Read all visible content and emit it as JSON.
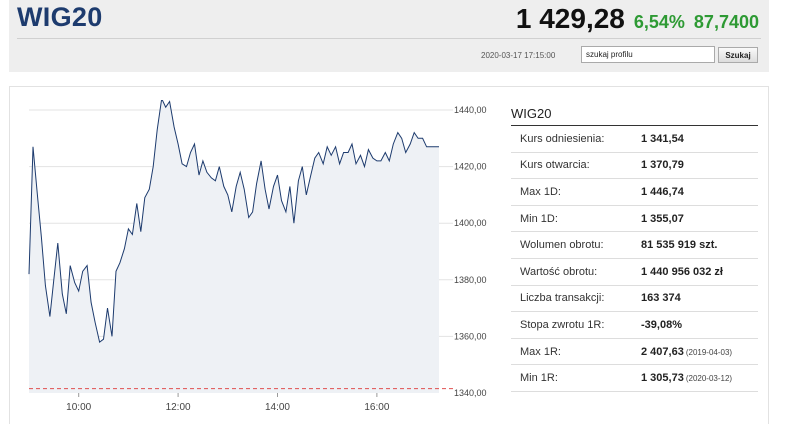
{
  "header": {
    "title": "WIG20",
    "last_price": "1 429,28",
    "change_pct": "6,54%",
    "change_abs": "87,7400",
    "timestamp": "2020-03-17 17:15:00",
    "search_value": "szukaj profilu",
    "search_button": "Szukaj"
  },
  "colors": {
    "title": "#1d3b6e",
    "positive": "#2e9a34",
    "line": "#1d3b6e",
    "reference_line": "#e05050"
  },
  "stats": {
    "title": "WIG20",
    "rows": [
      {
        "label": "Kurs odniesienia:",
        "value": "1 341,54",
        "note": ""
      },
      {
        "label": "Kurs otwarcia:",
        "value": "1 370,79",
        "note": ""
      },
      {
        "label": "Max 1D:",
        "value": "1 446,74",
        "note": ""
      },
      {
        "label": "Min 1D:",
        "value": "1 355,07",
        "note": ""
      },
      {
        "label": "Wolumen obrotu:",
        "value": "81 535 919 szt.",
        "note": ""
      },
      {
        "label": "Wartość obrotu:",
        "value": "1 440 956 032 zł",
        "note": ""
      },
      {
        "label": "Liczba transakcji:",
        "value": "163 374",
        "note": ""
      },
      {
        "label": "Stopa zwrotu 1R:",
        "value": "-39,08%",
        "note": ""
      },
      {
        "label": "Max 1R:",
        "value": "2 407,63",
        "note": "(2019-04-03)"
      },
      {
        "label": "Min 1R:",
        "value": "1 305,73",
        "note": "(2020-03-12)"
      }
    ]
  },
  "chart_data": {
    "type": "line",
    "xlim": [
      9.0,
      17.25
    ],
    "ylim": [
      1340,
      1440
    ],
    "y_ticks": [
      "1340,00",
      "1360,00",
      "1380,00",
      "1400,00",
      "1420,00",
      "1440,00"
    ],
    "x_ticks": [
      "10:00",
      "12:00",
      "14:00",
      "16:00"
    ],
    "reference_value": 1341.54,
    "grid": true,
    "x": [
      9.0,
      9.08,
      9.17,
      9.25,
      9.33,
      9.42,
      9.5,
      9.58,
      9.67,
      9.75,
      9.83,
      9.92,
      10.0,
      10.08,
      10.17,
      10.25,
      10.33,
      10.42,
      10.5,
      10.58,
      10.67,
      10.75,
      10.83,
      10.92,
      11.0,
      11.08,
      11.17,
      11.25,
      11.33,
      11.42,
      11.5,
      11.58,
      11.67,
      11.75,
      11.83,
      11.92,
      12.0,
      12.08,
      12.17,
      12.25,
      12.33,
      12.42,
      12.5,
      12.58,
      12.67,
      12.75,
      12.83,
      12.92,
      13.0,
      13.08,
      13.17,
      13.25,
      13.33,
      13.42,
      13.5,
      13.58,
      13.67,
      13.75,
      13.83,
      13.92,
      14.0,
      14.08,
      14.17,
      14.25,
      14.33,
      14.42,
      14.5,
      14.58,
      14.67,
      14.75,
      14.83,
      14.92,
      15.0,
      15.08,
      15.17,
      15.25,
      15.33,
      15.42,
      15.5,
      15.58,
      15.67,
      15.75,
      15.83,
      15.92,
      16.0,
      16.08,
      16.17,
      16.25,
      16.33,
      16.42,
      16.5,
      16.58,
      16.67,
      16.75,
      16.83,
      16.92,
      17.0,
      17.08,
      17.17,
      17.25
    ],
    "values": [
      1382,
      1427,
      1410,
      1395,
      1378,
      1367,
      1380,
      1393,
      1375,
      1368,
      1385,
      1379,
      1376,
      1383,
      1385,
      1372,
      1365,
      1358,
      1359,
      1370,
      1360,
      1383,
      1386,
      1391,
      1398,
      1396,
      1407,
      1397,
      1409,
      1412,
      1420,
      1433,
      1444,
      1441,
      1443,
      1434,
      1428,
      1421,
      1420,
      1425,
      1428,
      1417,
      1422,
      1418,
      1416,
      1415,
      1420,
      1413,
      1410,
      1404,
      1413,
      1418,
      1412,
      1402,
      1404,
      1414,
      1422,
      1412,
      1405,
      1413,
      1417,
      1408,
      1404,
      1413,
      1400,
      1415,
      1420,
      1410,
      1417,
      1423,
      1425,
      1421,
      1427,
      1424,
      1427,
      1421,
      1425,
      1425,
      1428,
      1421,
      1424,
      1420,
      1426,
      1423,
      1422,
      1422,
      1425,
      1422,
      1428,
      1432,
      1430,
      1425,
      1428,
      1432,
      1430,
      1430,
      1427,
      1427,
      1427,
      1427
    ]
  }
}
